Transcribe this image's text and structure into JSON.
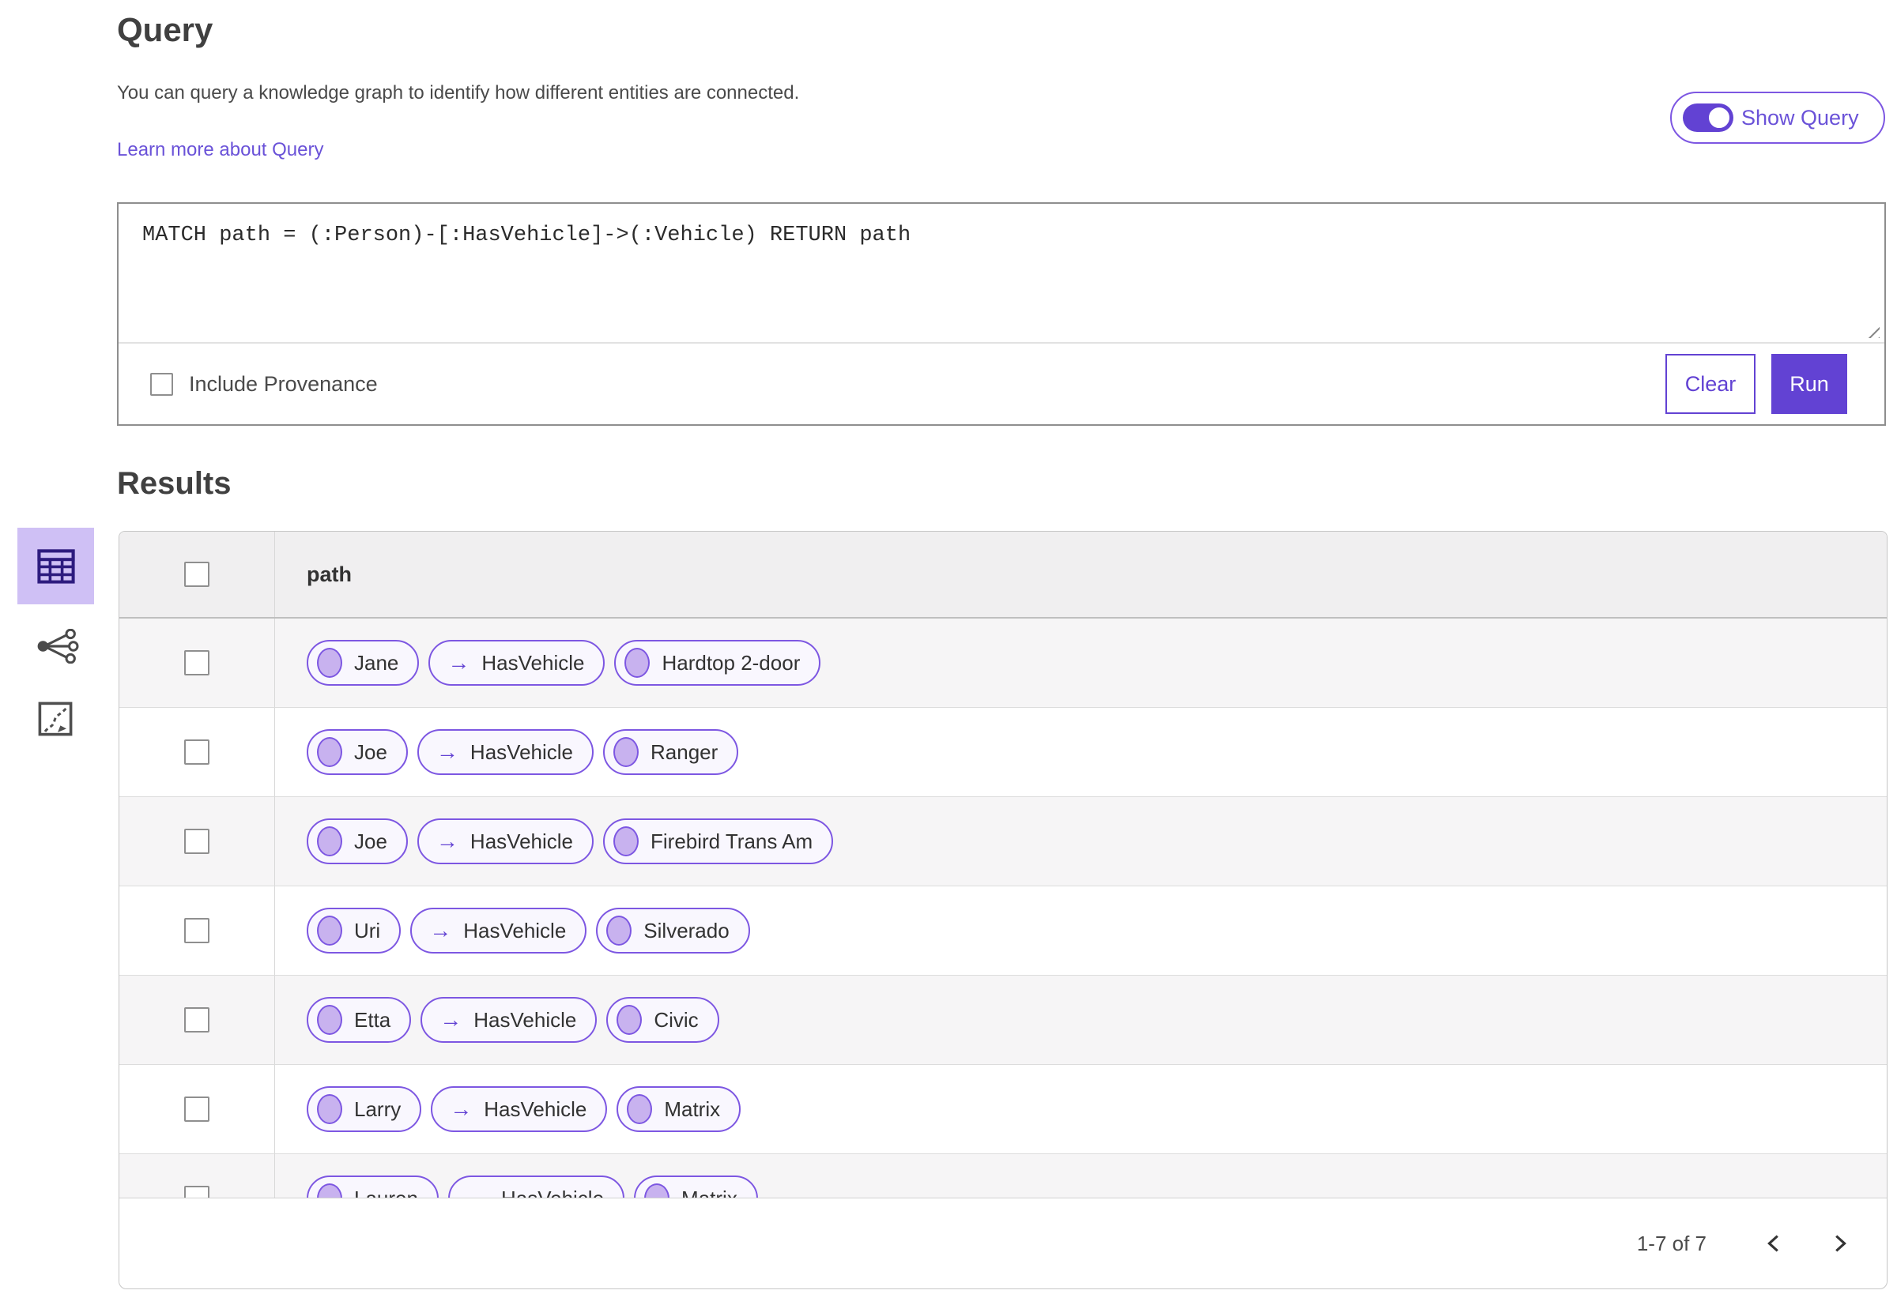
{
  "colors": {
    "accent": "#6242d3",
    "accent_border": "#7d57e2",
    "pill_bg": "#f9f7fe",
    "node_fill": "#c8b2ef",
    "link": "#6a52d8",
    "selected_tile_bg": "#cfc0f5",
    "tile_icon": "#2d1b7e",
    "heading_text": "#404040",
    "body_text": "#4a4a4a",
    "code_text": "#2b2b2b"
  },
  "icons": {
    "edge_arrow": "→",
    "view_switcher": [
      "table-view-icon",
      "link-chart-view-icon",
      "map-view-icon"
    ],
    "pagination": [
      "chevron-left-icon",
      "chevron-right-icon"
    ],
    "other": [
      "resize-handle-icon",
      "toggle-on-icon"
    ]
  },
  "query_section": {
    "title": "Query",
    "description": "You can query a knowledge graph to identify how different entities are connected.",
    "learn_more_label": "Learn more about Query",
    "show_query_label": "Show Query",
    "show_query_on": true,
    "query_text": "MATCH path = (:Person)-[:HasVehicle]->(:Vehicle) RETURN path",
    "include_provenance_label": "Include Provenance",
    "include_provenance_checked": false,
    "clear_label": "Clear",
    "run_label": "Run"
  },
  "results_section": {
    "title": "Results",
    "view_switcher": [
      {
        "name": "table-view",
        "selected": true
      },
      {
        "name": "link-chart-view",
        "selected": false
      },
      {
        "name": "map-view",
        "selected": false
      }
    ],
    "table": {
      "column_header": "path",
      "select_all_checked": false,
      "rows": [
        {
          "entity": "Jane",
          "relationship": "HasVehicle",
          "target": "Hardtop 2-door",
          "checked": false
        },
        {
          "entity": "Joe",
          "relationship": "HasVehicle",
          "target": "Ranger",
          "checked": false
        },
        {
          "entity": "Joe",
          "relationship": "HasVehicle",
          "target": "Firebird Trans Am",
          "checked": false
        },
        {
          "entity": "Uri",
          "relationship": "HasVehicle",
          "target": "Silverado",
          "checked": false
        },
        {
          "entity": "Etta",
          "relationship": "HasVehicle",
          "target": "Civic",
          "checked": false
        },
        {
          "entity": "Larry",
          "relationship": "HasVehicle",
          "target": "Matrix",
          "checked": false
        },
        {
          "entity": "Lauren",
          "relationship": "HasVehicle",
          "target": "Matrix",
          "checked": false
        }
      ]
    },
    "pagination": {
      "range_label": "1-7 of 7"
    }
  }
}
